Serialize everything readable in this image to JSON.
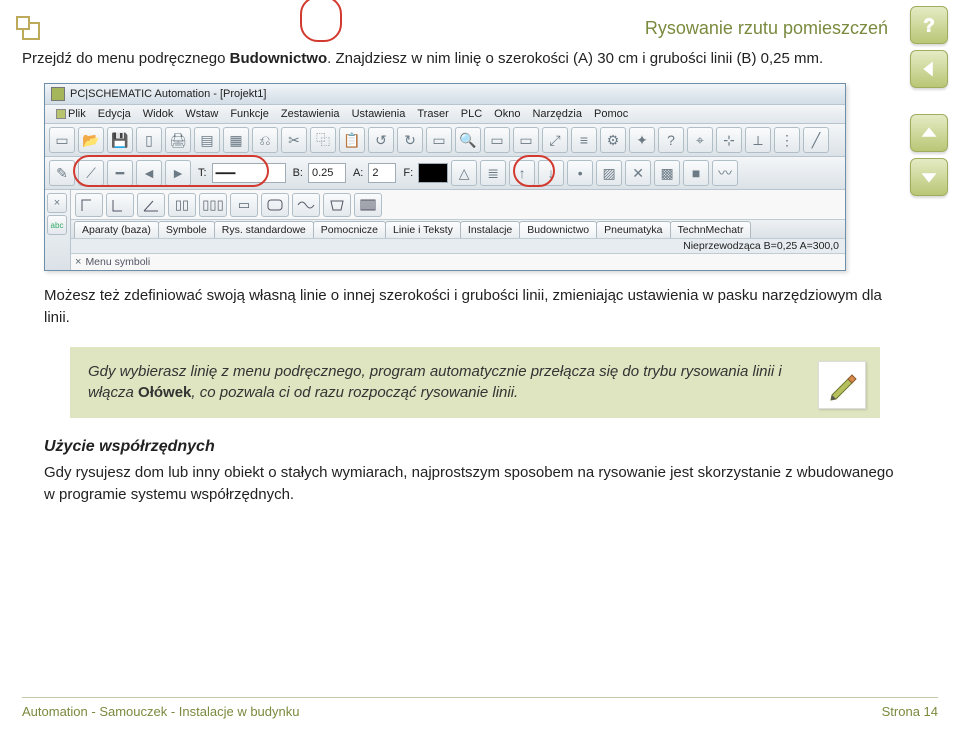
{
  "header": {
    "page_title": "Rysowanie rzutu pomieszczeń"
  },
  "intro": {
    "prefix": "Przejdź do menu podręcznego ",
    "bold1": "Budownictwo",
    "middle": ". Znajdziesz w nim linię o szerokości (A) 30 cm i grubości linii (B) 0,25 mm."
  },
  "app": {
    "title": "PC|SCHEMATIC Automation - [Projekt1]",
    "menus": [
      "Plik",
      "Edycja",
      "Widok",
      "Wstaw",
      "Funkcje",
      "Zestawienia",
      "Ustawienia",
      "Traser",
      "PLC",
      "Okno",
      "Narzędzia",
      "Pomoc"
    ],
    "fieldT_label": "T:",
    "fieldB_label": "B:",
    "fieldB_value": "0.25",
    "fieldA_label": "A:",
    "fieldA_value": "2",
    "fieldF_label": "F:",
    "tabs": [
      "Aparaty (baza)",
      "Symbole",
      "Rys. standardowe",
      "Pomocnicze",
      "Linie i Teksty",
      "Instalacje",
      "Budownictwo",
      "Pneumatyka",
      "TechnMechatr"
    ],
    "status": "Nieprzewodząca B=0,25 A=300,0",
    "bottom_label": "Menu symboli"
  },
  "para2": "Możesz też zdefiniować swoją własną linie o innej szerokości i grubości linii, zmieniając ustawienia w pasku narzędziowym dla linii.",
  "info": {
    "p1": "Gdy wybierasz linię z menu podręcznego, program automatycznie przełącza się do trybu rysowania linii i włącza ",
    "pencil": "Ołówek",
    "p2": ", co pozwala ci od razu rozpocząć rysowanie linii."
  },
  "section": {
    "heading": "Użycie współrzędnych",
    "body": "Gdy rysujesz dom lub inny obiekt o stałych wymiarach, najprostszym sposobem na rysowanie jest skorzystanie z wbudowanego w programie systemu współrzędnych."
  },
  "footer": {
    "left": "Automation - Samouczek - Instalacje w budynku",
    "right": "Strona 14"
  }
}
